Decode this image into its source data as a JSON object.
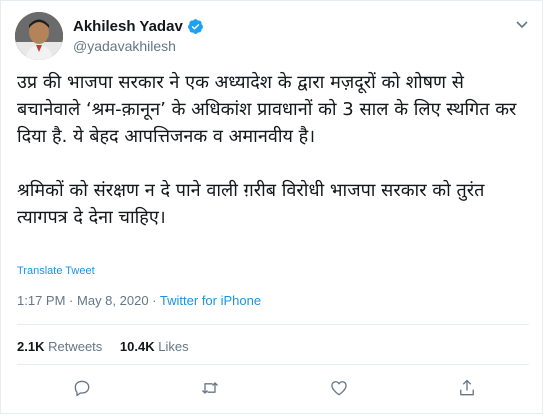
{
  "author": {
    "name": "Akhilesh Yadav",
    "handle": "@yadavakhilesh",
    "verified": true
  },
  "tweet": {
    "paragraphs": [
      "उप्र की भाजपा सरकार ने एक अध्यादेश के द्वारा मज़दूरों को शोषण से बचानेवाले  ‘श्रम-क़ानून’ के अधिकांश प्रावधानों को 3 साल के लिए स्थगित कर दिया है. ये बेहद आपत्तिजनक व अमानवीय है।",
      "श्रमिकों को संरक्षण न दे पाने वाली ग़रीब विरोधी भाजपा सरकार को तुरंत त्यागपत्र दे देना चाहिए।"
    ],
    "translate_label": "Translate Tweet",
    "time": "1:17 PM",
    "date": "May 8, 2020",
    "separator": "·",
    "source": "Twitter for iPhone"
  },
  "stats": {
    "retweets_count": "2.1K",
    "retweets_label": "Retweets",
    "likes_count": "10.4K",
    "likes_label": "Likes"
  },
  "icons": {
    "verified": "verified-badge-icon",
    "caret": "chevron-down-icon",
    "reply": "reply-icon",
    "retweet": "retweet-icon",
    "like": "heart-icon",
    "share": "share-icon"
  },
  "colors": {
    "link": "#1b95e0",
    "muted": "#657786",
    "text": "#14171a",
    "border": "#e6ecf0"
  }
}
